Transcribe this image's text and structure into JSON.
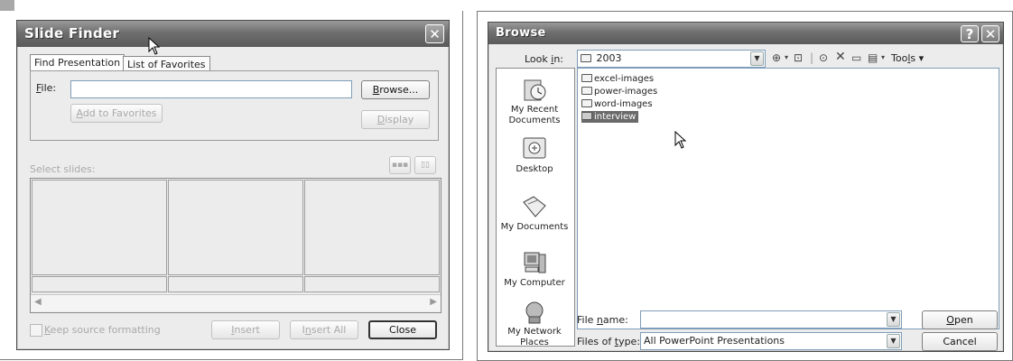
{
  "slide_finder": {
    "title": "Slide Finder",
    "tabs": [
      "Find Presentation",
      "List of Favorites"
    ],
    "file_label": "File:",
    "file_value": "",
    "browse_label": "Browse...",
    "add_favorites_label": "Add to Favorites",
    "display_label": "Display",
    "select_slides_label": "Select slides:",
    "keep_formatting_label": "Keep source formatting",
    "insert_label": "Insert",
    "insert_all_label": "Insert All",
    "close_label": "Close"
  },
  "browse": {
    "title": "Browse",
    "look_in_label": "Look in:",
    "look_in_value": "2003",
    "tools_label": "Tools",
    "places": [
      "My Recent Documents",
      "Desktop",
      "My Documents",
      "My Computer",
      "My Network Places"
    ],
    "files": [
      {
        "name": "excel-images",
        "type": "folder"
      },
      {
        "name": "power-images",
        "type": "folder"
      },
      {
        "name": "word-images",
        "type": "folder"
      },
      {
        "name": "interview",
        "type": "presentation",
        "selected": true
      }
    ],
    "file_name_label": "File name:",
    "file_name_value": "",
    "files_of_type_label": "Files of type:",
    "files_of_type_value": "All PowerPoint Presentations",
    "open_label": "Open",
    "cancel_label": "Cancel"
  }
}
